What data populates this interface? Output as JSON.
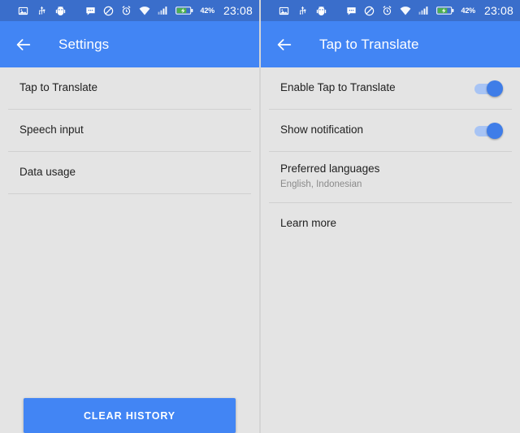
{
  "status_bar": {
    "icons_left": [
      "image-icon",
      "usb-icon",
      "android-debug-icon"
    ],
    "icons_right": [
      "sms-icon",
      "do-not-disturb-icon",
      "alarm-icon",
      "wifi-icon",
      "signal-icon",
      "battery-charging-icon"
    ],
    "battery_percent": "42%",
    "clock": "23:08",
    "background": "#3a6ecb"
  },
  "theme": {
    "accent": "#4285f4",
    "appbar": "#4285f4",
    "background": "#e4e4e4",
    "divider": "#d0d0d0",
    "title_text": "#212121",
    "subtitle_text": "#8a8a8a"
  },
  "left_screen": {
    "appbar": {
      "back_icon": "arrow-back-icon",
      "title": "Settings"
    },
    "items": [
      {
        "title": "Tap to Translate"
      },
      {
        "title": "Speech input"
      },
      {
        "title": "Data usage"
      }
    ],
    "clear_history_label": "CLEAR HISTORY"
  },
  "right_screen": {
    "appbar": {
      "back_icon": "arrow-back-icon",
      "title": "Tap to Translate"
    },
    "items": [
      {
        "title": "Enable Tap to Translate",
        "type": "switch",
        "state": "on"
      },
      {
        "title": "Show notification",
        "type": "switch",
        "state": "on"
      },
      {
        "title": "Preferred languages",
        "subtitle": "English, Indonesian",
        "type": "two-line"
      },
      {
        "title": "Learn more",
        "type": "simple"
      }
    ]
  }
}
